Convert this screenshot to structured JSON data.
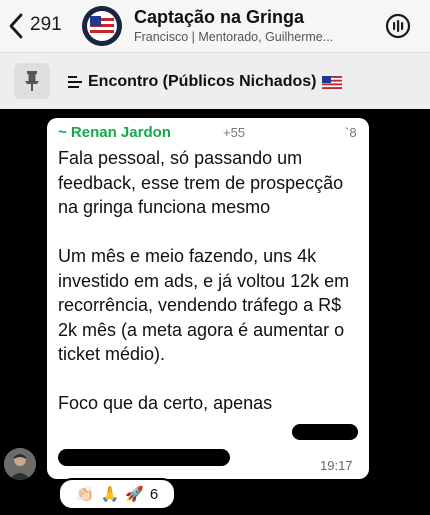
{
  "header": {
    "back_count": "291",
    "title": "Captação na Gringa",
    "subtitle": "Francisco | Mentorado, Guilherme..."
  },
  "pinned": {
    "title": "Encontro (Públicos Nichados)"
  },
  "message": {
    "sender": "~ Renan Jardon",
    "phone_prefix": "+55",
    "phone_suffix": "`8",
    "paragraph1": "Fala pessoal, só passando um feedback, esse trem de prospecção na gringa funciona mesmo",
    "paragraph2": "Um mês e meio fazendo, uns 4k investido em ads, e já voltou 12k em recorrência, vendendo tráfego a R$ 2k mês (a meta agora é aumentar o ticket médio).",
    "paragraph3": "Foco que da certo, apenas",
    "time": "19:17"
  },
  "reactions": {
    "emoji1": "👏🏻",
    "emoji2": "🙏",
    "emoji3": "🚀",
    "count": "6"
  },
  "colors": {
    "sender": "#17a84a",
    "header_bg": "#f6f6f6",
    "chat_bg": "#000000"
  }
}
